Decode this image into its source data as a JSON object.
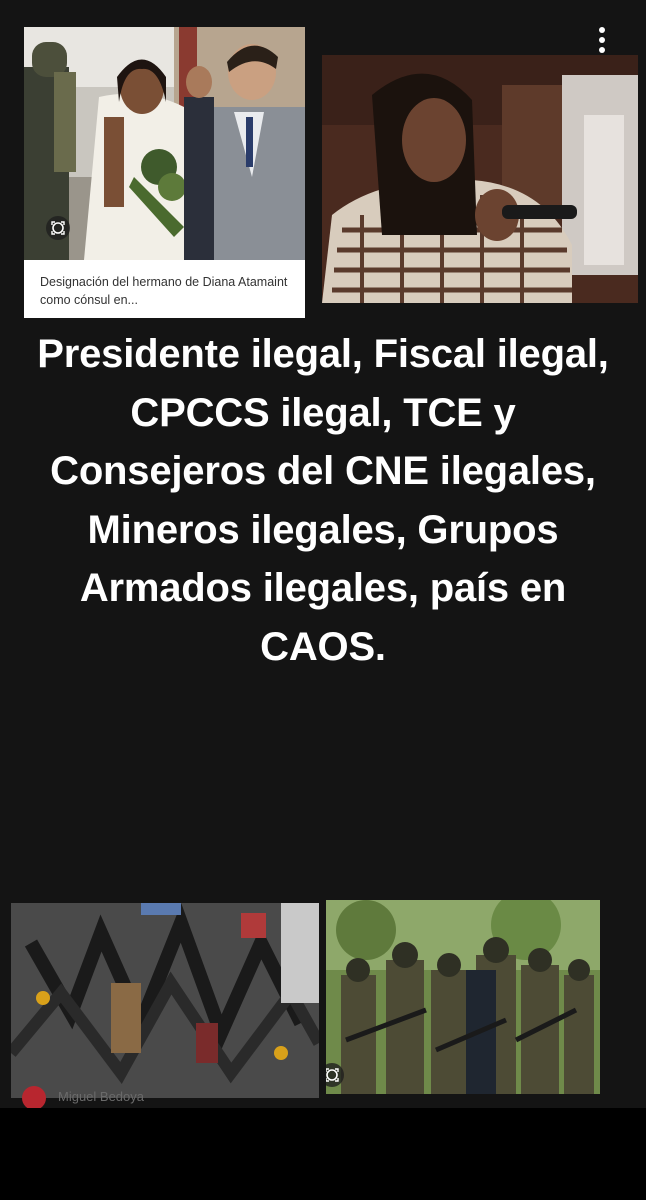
{
  "menu": {
    "more_icon": "more-vertical-icon"
  },
  "cards": {
    "top_left": {
      "caption": "Designación del hermano de Diana Atamaint como cónsul en...",
      "badge_icon": "lens-search-icon"
    },
    "bottom_right": {
      "badge_icon": "lens-search-icon"
    }
  },
  "headline": {
    "text": "Presidente ilegal, Fiscal ilegal, CPCCS ilegal, TCE y Consejeros del CNE ilegales, Mineros ilegales, Grupos Armados ilegales, país en CAOS."
  },
  "author": {
    "name": "Miguel Bedoya",
    "avatar_color": "#b8262f"
  },
  "colors": {
    "background": "#141414",
    "text": "#ffffff",
    "caption_text": "#333333"
  }
}
